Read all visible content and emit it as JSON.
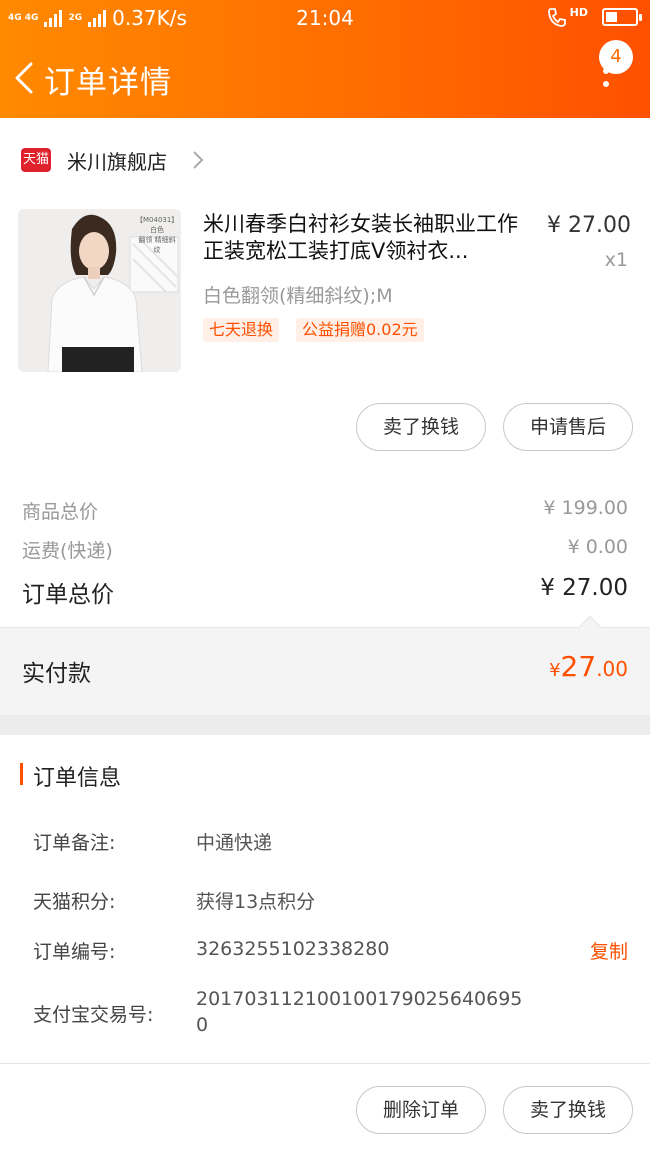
{
  "status_bar": {
    "network": "4G 4G",
    "network2": "2G",
    "speed": "0.37K/s",
    "time": "21:04",
    "call_label": "HD"
  },
  "header": {
    "title": "订单详情",
    "badge_count": "4"
  },
  "store": {
    "badge": "天猫",
    "name": "米川旗舰店"
  },
  "product": {
    "title": "米川春季白衬衫女装长袖职业工作正装宽松工装打底V领衬衣...",
    "price": "¥ 27.00",
    "quantity": "x1",
    "spec": "白色翻领(精细斜纹);M",
    "image_text": [
      "【M04031】",
      "白色",
      "翻领 精细斜纹"
    ],
    "tags": [
      "七天退换",
      "公益捐赠0.02元"
    ]
  },
  "actions_top": {
    "sell_label": "卖了换钱",
    "after_sale_label": "申请售后"
  },
  "summary": {
    "goods_total_label": "商品总价",
    "goods_total_value": "¥ 199.00",
    "shipping_label": "运费(快递)",
    "shipping_value": "¥ 0.00",
    "order_total_label": "订单总价",
    "order_total_value": "¥ 27.00",
    "paid_label": "实付款",
    "paid_currency": "¥",
    "paid_int": "27",
    "paid_dec": ".00"
  },
  "order_info": {
    "title": "订单信息",
    "remark_label": "订单备注:",
    "remark_value": "中通快递",
    "points_label": "天猫积分:",
    "points_value": "获得13点积分",
    "order_no_label": "订单编号:",
    "order_no_value": "3263255102338280",
    "copy_label": "复制",
    "alipay_label": "支付宝交易号:",
    "alipay_value_line1": "201703112100100179025640695",
    "alipay_value_line2": "0"
  },
  "actions_bottom": {
    "delete_label": "删除订单",
    "sell_label": "卖了换钱"
  },
  "colors": {
    "accent": "#ff5000",
    "header_start": "#ff8a00",
    "header_end": "#ff5000",
    "tmall_red": "#e0222c"
  }
}
